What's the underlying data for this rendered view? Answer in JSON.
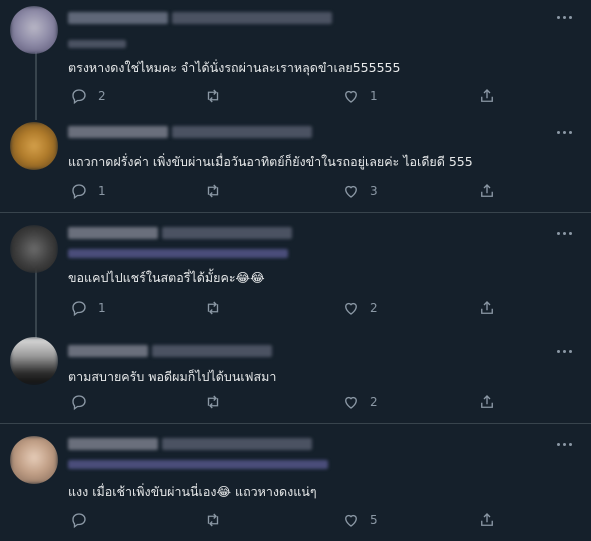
{
  "tweets": [
    {
      "text": "ตรงหางดงใช่ไหมคะ จำได้นั่งรถผ่านละเราหลุดขำเลย555555",
      "replies": "2",
      "retweets": "",
      "likes": "1"
    },
    {
      "text": "แถวกาดฝรั่งค่า เพิ่งขับผ่านเมื่อวันอาทิตย์ก็ยังขำในรถอยู่เลยค่ะ ไอเดียดี 555",
      "replies": "1",
      "retweets": "",
      "likes": "3"
    },
    {
      "text": "ขอแคปไปแชร์ในสตอรี่ได้มั้ยคะ😂😂",
      "replies": "1",
      "retweets": "",
      "likes": "2"
    },
    {
      "text": "ตามสบายครับ พอดีผมก็ไปได้บนเฟสมา",
      "replies": "",
      "retweets": "",
      "likes": "2"
    },
    {
      "text": "แงง เมื่อเช้าเพิ่งขับผ่านนี่เอง😂 แถวหางดงแน่ๆ",
      "replies": "",
      "retweets": "",
      "likes": "5"
    }
  ],
  "icons": {
    "reply": "reply-icon",
    "retweet": "retweet-icon",
    "like": "like-icon",
    "share": "share-icon",
    "more": "more-icon"
  }
}
